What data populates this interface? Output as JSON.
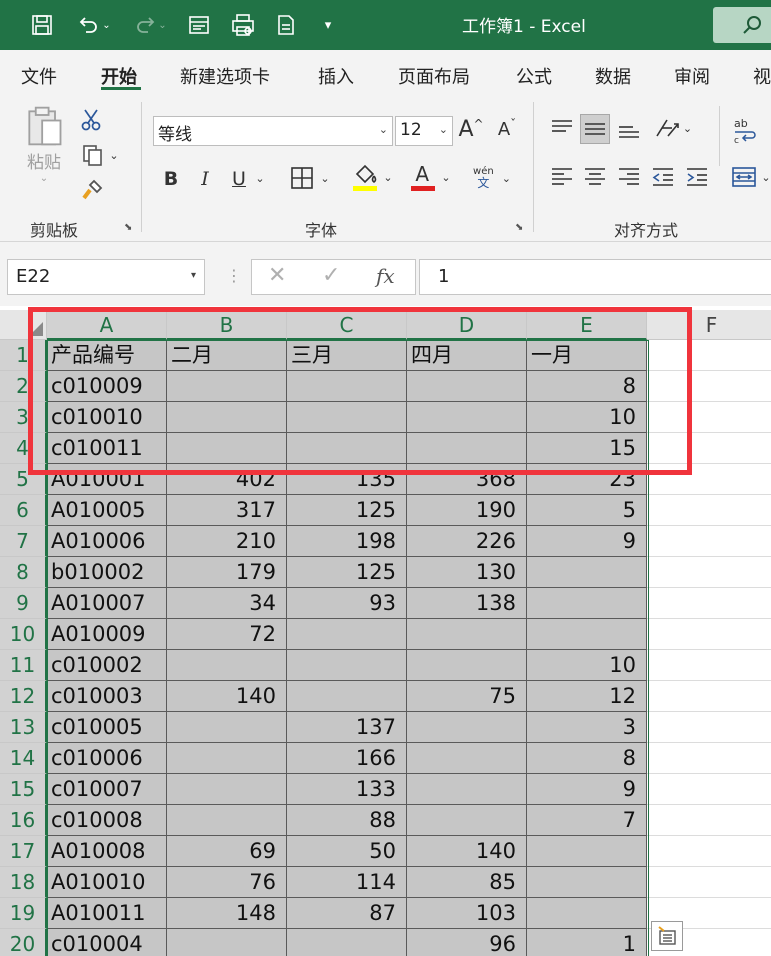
{
  "window": {
    "title": "工作簿1  -  Excel"
  },
  "tabs": [
    "文件",
    "开始",
    "新建选项卡",
    "插入",
    "页面布局",
    "公式",
    "数据",
    "审阅",
    "视"
  ],
  "active_tab": "开始",
  "ribbon": {
    "clipboard": {
      "label": "剪贴板",
      "paste": "粘贴"
    },
    "font": {
      "label": "字体",
      "name": "等线",
      "size": "12",
      "bold": "B",
      "italic": "I",
      "underline": "U",
      "color_letter": "A",
      "phonetic_top": "wén",
      "phonetic_bottom": "文"
    },
    "alignment": {
      "label": "对齐方式"
    }
  },
  "formula_bar": {
    "name_box": "E22",
    "formula": "1"
  },
  "colors": {
    "accent": "#217346",
    "highlight_red": "#f0343c",
    "fill_yellow": "#ffff00",
    "font_red": "#e02020"
  },
  "sheet": {
    "columns": [
      "A",
      "B",
      "C",
      "D",
      "E",
      "F"
    ],
    "rows": [
      {
        "num": "1",
        "cells": [
          "产品编号",
          "二月",
          "三月",
          "四月",
          "一月"
        ]
      },
      {
        "num": "2",
        "cells": [
          "c010009",
          "",
          "",
          "",
          "8"
        ]
      },
      {
        "num": "3",
        "cells": [
          "c010010",
          "",
          "",
          "",
          "10"
        ]
      },
      {
        "num": "4",
        "cells": [
          "c010011",
          "",
          "",
          "",
          "15"
        ]
      },
      {
        "num": "5",
        "cells": [
          "A010001",
          "402",
          "135",
          "368",
          "23"
        ]
      },
      {
        "num": "6",
        "cells": [
          "A010005",
          "317",
          "125",
          "190",
          "5"
        ]
      },
      {
        "num": "7",
        "cells": [
          "A010006",
          "210",
          "198",
          "226",
          "9"
        ]
      },
      {
        "num": "8",
        "cells": [
          "b010002",
          "179",
          "125",
          "130",
          ""
        ]
      },
      {
        "num": "9",
        "cells": [
          "A010007",
          "34",
          "93",
          "138",
          ""
        ]
      },
      {
        "num": "10",
        "cells": [
          "A010009",
          "72",
          "",
          "",
          ""
        ]
      },
      {
        "num": "11",
        "cells": [
          "c010002",
          "",
          "",
          "",
          "10"
        ]
      },
      {
        "num": "12",
        "cells": [
          "c010003",
          "140",
          "",
          "75",
          "12"
        ]
      },
      {
        "num": "13",
        "cells": [
          "c010005",
          "",
          "137",
          "",
          "3"
        ]
      },
      {
        "num": "14",
        "cells": [
          "c010006",
          "",
          "166",
          "",
          "8"
        ]
      },
      {
        "num": "15",
        "cells": [
          "c010007",
          "",
          "133",
          "",
          "9"
        ]
      },
      {
        "num": "16",
        "cells": [
          "c010008",
          "",
          "88",
          "",
          "7"
        ]
      },
      {
        "num": "17",
        "cells": [
          "A010008",
          "69",
          "50",
          "140",
          ""
        ]
      },
      {
        "num": "18",
        "cells": [
          "A010010",
          "76",
          "114",
          "85",
          ""
        ]
      },
      {
        "num": "19",
        "cells": [
          "A010011",
          "148",
          "87",
          "103",
          ""
        ]
      },
      {
        "num": "20",
        "cells": [
          "c010004",
          "",
          "",
          "96",
          "1"
        ]
      }
    ]
  }
}
